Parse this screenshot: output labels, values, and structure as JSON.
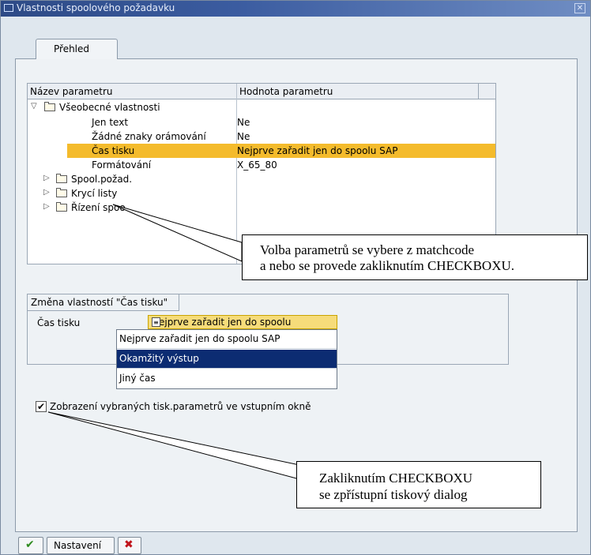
{
  "window": {
    "title": "Vlastnosti spoolového požadavku",
    "close_icon": "close-icon"
  },
  "tabs": [
    {
      "label": "Přehled"
    }
  ],
  "tree": {
    "headers": {
      "name": "Název parametru",
      "value": "Hodnota parametru"
    },
    "group": "Všeobecné vlastnosti",
    "items": [
      {
        "name": "Jen text",
        "value": "Ne"
      },
      {
        "name": "Žádné znaky orámování",
        "value": "Ne"
      },
      {
        "name": "Čas tisku",
        "value": "Nejprve zařadit jen do spoolu SAP"
      },
      {
        "name": "Formátování",
        "value": "X_65_80"
      }
    ],
    "folders": [
      "Spool.požad.",
      "Krycí listy",
      "Řízení spoo"
    ]
  },
  "change": {
    "title": "Změna vlastností \"Čas tisku\"",
    "label": "Čas tisku",
    "value": "Nejprve zařadit jen do spoolu"
  },
  "dropdown": {
    "options": [
      "Nejprve zařadit jen do spoolu SAP",
      "Okamžitý výstup",
      "Jiný čas"
    ]
  },
  "checkbox": {
    "label": "Zobrazení vybraných tisk.parametrů ve vstupním okně",
    "checked": true
  },
  "callout1": {
    "line1": "Volba parametrů se vybere z matchcode",
    "line2": " a nebo se provede zakliknutím CHECKBOXU."
  },
  "callout2": {
    "line1": "Zakliknutím  CHECKBOXU",
    "line2": " se zpřístupní  tiskový dialog"
  },
  "footer": {
    "settings_label": "Nastavení"
  },
  "colors": {
    "highlight": "#f4bb2c",
    "selection": "#0c2c72"
  }
}
